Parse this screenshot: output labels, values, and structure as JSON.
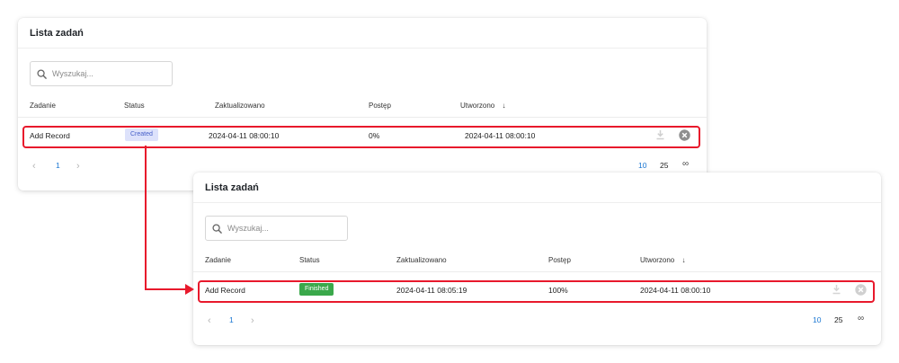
{
  "colors": {
    "accent": "#1976d2",
    "highlight": "#e8192c",
    "created_bg": "#dde2fb",
    "finished_bg": "#3aa84b"
  },
  "before": {
    "title": "Lista zadań",
    "search_placeholder": "Wyszukaj...",
    "columns": [
      "Zadanie",
      "Status",
      "Zaktualizowano",
      "Postęp",
      "Utworzono"
    ],
    "sort_indicator": "↓",
    "row": {
      "task": "Add Record",
      "status": "Created",
      "updated": "2024-04-11 08:00:10",
      "progress": "0%",
      "created": "2024-04-11 08:00:10"
    },
    "pager": {
      "prev": "‹",
      "page": "1",
      "next": "›"
    },
    "page_sizes": [
      "10",
      "25",
      "∞"
    ]
  },
  "after": {
    "title": "Lista zadań",
    "search_placeholder": "Wyszukaj...",
    "columns": [
      "Zadanie",
      "Status",
      "Zaktualizowano",
      "Postęp",
      "Utworzono"
    ],
    "sort_indicator": "↓",
    "row": {
      "task": "Add Record",
      "status": "Finished",
      "updated": "2024-04-11 08:05:19",
      "progress": "100%",
      "created": "2024-04-11 08:00:10"
    },
    "pager": {
      "prev": "‹",
      "page": "1",
      "next": "›"
    },
    "page_sizes": [
      "10",
      "25",
      "∞"
    ]
  }
}
